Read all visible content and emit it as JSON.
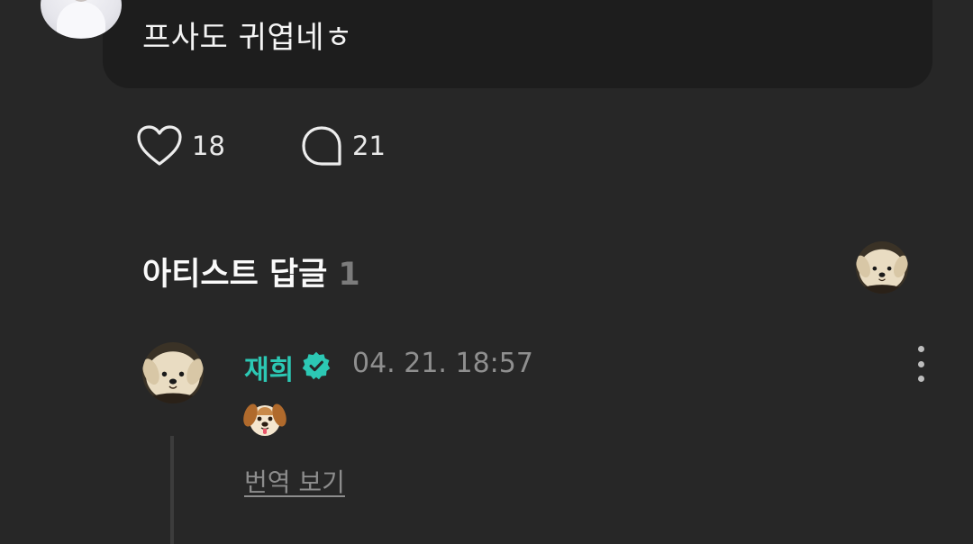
{
  "post": {
    "text": "프사도 귀엽네ㅎ"
  },
  "actions": {
    "like_count": "18",
    "reply_count": "21"
  },
  "artist_replies": {
    "title": "아티스트 답글",
    "count": "1"
  },
  "comment": {
    "author": "재희",
    "timestamp": "04. 21. 18:57",
    "content_icon": "dog-face-emoji",
    "translate_label": "번역 보기"
  },
  "colors": {
    "background": "#272727",
    "card": "#1d1d1d",
    "accent": "#2cc8b4",
    "muted": "#8f8f8f"
  },
  "icons": [
    "heart-icon",
    "speech-bubble-icon",
    "verified-badge-icon",
    "more-vertical-icon",
    "dog-face-emoji"
  ]
}
